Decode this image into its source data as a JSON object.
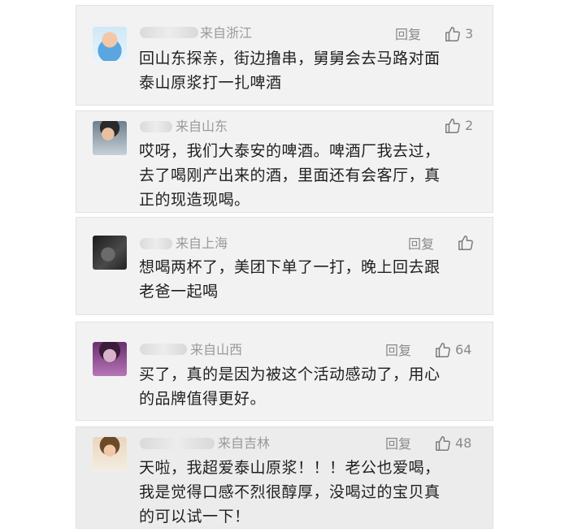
{
  "comments": [
    {
      "location": "来自浙江",
      "reply_label": "回复",
      "likes": "3",
      "lines": [
        "回山东探亲，街边撸串，舅舅会去马路对面",
        "泰山原浆打一扎啤酒"
      ]
    },
    {
      "location": "来自山东",
      "reply_label": "",
      "likes": "2",
      "lines": [
        "哎呀，我们大泰安的啤酒。啤酒厂我去过，",
        "去了喝刚产出来的酒，里面还有会客厅，真",
        "正的现造现喝。"
      ]
    },
    {
      "location": "来自上海",
      "reply_label": "回复",
      "likes": "",
      "lines": [
        "想喝两杯了，美团下单了一打，晚上回去跟",
        "老爸一起喝"
      ]
    },
    {
      "location": "来自山西",
      "reply_label": "回复",
      "likes": "64",
      "lines": [
        "买了，真的是因为被这个活动感动了，用心",
        "的品牌值得更好。"
      ]
    },
    {
      "location": "来自吉林",
      "reply_label": "回复",
      "likes": "48",
      "lines": [
        "天啦，我超爱泰山原浆！！！老公也爱喝，",
        "我是觉得口感不烈很醇厚，没喝过的宝贝真",
        "的可以试一下！"
      ]
    }
  ],
  "colors": {
    "card_bg": "#f2f2f2",
    "text": "#1f1f1f",
    "meta": "#9a9a9a"
  },
  "icons": {
    "like": "thumbs-up-icon"
  }
}
